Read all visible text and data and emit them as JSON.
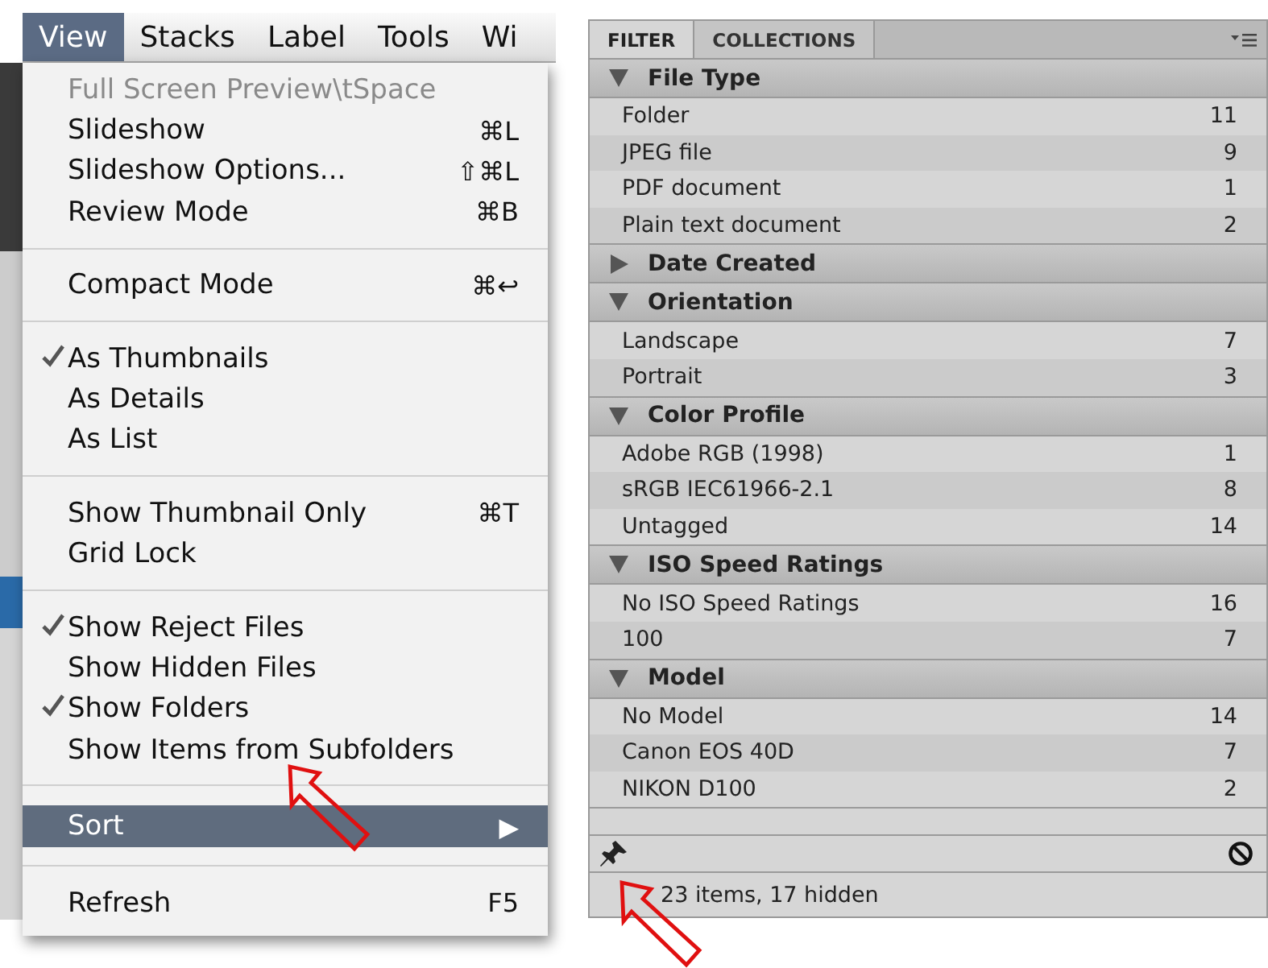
{
  "menu_bar": {
    "items": [
      {
        "label": "View",
        "selected": true
      },
      {
        "label": "Stacks",
        "selected": false
      },
      {
        "label": "Label",
        "selected": false
      },
      {
        "label": "Tools",
        "selected": false
      },
      {
        "label": "Wi",
        "selected": false
      }
    ]
  },
  "menu": {
    "items": [
      {
        "kind": "item",
        "label": "Full Screen Preview\\tSpace",
        "disabled": true,
        "checked": false,
        "selected": false
      },
      {
        "kind": "item",
        "label": "Slideshow",
        "shortcut": "⌘L",
        "disabled": false,
        "checked": false,
        "selected": false
      },
      {
        "kind": "item",
        "label": "Slideshow Options...",
        "shortcut": "⇧⌘L",
        "disabled": false,
        "checked": false,
        "selected": false
      },
      {
        "kind": "item",
        "label": "Review Mode",
        "shortcut": "⌘B",
        "disabled": false,
        "checked": false,
        "selected": false
      },
      {
        "kind": "separator"
      },
      {
        "kind": "item",
        "label": "Compact Mode",
        "shortcut": "⌘↩",
        "disabled": false,
        "checked": false,
        "selected": false
      },
      {
        "kind": "separator"
      },
      {
        "kind": "item",
        "label": "As Thumbnails",
        "disabled": false,
        "checked": true,
        "selected": false
      },
      {
        "kind": "item",
        "label": "As Details",
        "disabled": false,
        "checked": false,
        "selected": false
      },
      {
        "kind": "item",
        "label": "As List",
        "disabled": false,
        "checked": false,
        "selected": false
      },
      {
        "kind": "separator"
      },
      {
        "kind": "item",
        "label": "Show Thumbnail Only",
        "shortcut": "⌘T",
        "disabled": false,
        "checked": false,
        "selected": false
      },
      {
        "kind": "item",
        "label": "Grid Lock",
        "disabled": false,
        "checked": false,
        "selected": false
      },
      {
        "kind": "separator"
      },
      {
        "kind": "item",
        "label": "Show Reject Files",
        "disabled": false,
        "checked": true,
        "selected": false
      },
      {
        "kind": "item",
        "label": "Show Hidden Files",
        "disabled": false,
        "checked": false,
        "selected": false
      },
      {
        "kind": "item",
        "label": "Show Folders",
        "disabled": false,
        "checked": true,
        "selected": false
      },
      {
        "kind": "item",
        "label": "Show Items from Subfolders",
        "disabled": false,
        "checked": false,
        "selected": false
      },
      {
        "kind": "separator"
      },
      {
        "kind": "submenu",
        "label": "Sort",
        "arrow": "▶",
        "disabled": false,
        "checked": false,
        "selected": true
      },
      {
        "kind": "separator"
      },
      {
        "kind": "item",
        "label": "Refresh",
        "shortcut": "F5",
        "disabled": false,
        "checked": false,
        "selected": false
      }
    ]
  },
  "filter_panel": {
    "tabs": [
      {
        "label": "FILTER",
        "selected": true
      },
      {
        "label": "COLLECTIONS",
        "selected": false
      }
    ],
    "sections": [
      {
        "title": "File Type",
        "expanded": true,
        "rows": [
          {
            "label": "Folder",
            "count": "11"
          },
          {
            "label": "JPEG file",
            "count": "9"
          },
          {
            "label": "PDF document",
            "count": "1"
          },
          {
            "label": "Plain text document",
            "count": "2"
          }
        ]
      },
      {
        "title": "Date Created",
        "expanded": false
      },
      {
        "title": "Orientation",
        "expanded": true,
        "rows": [
          {
            "label": "Landscape",
            "count": "7"
          },
          {
            "label": "Portrait",
            "count": "3"
          }
        ]
      },
      {
        "title": "Color Profile",
        "expanded": true,
        "rows": [
          {
            "label": "Adobe RGB (1998)",
            "count": "1"
          },
          {
            "label": "sRGB IEC61966-2.1",
            "count": "8"
          },
          {
            "label": "Untagged",
            "count": "14"
          }
        ]
      },
      {
        "title": "ISO Speed Ratings",
        "expanded": true,
        "rows": [
          {
            "label": "No ISO Speed Ratings",
            "count": "16"
          },
          {
            "label": "100",
            "count": "7"
          }
        ]
      },
      {
        "title": "Model",
        "expanded": true,
        "rows": [
          {
            "label": "No Model",
            "count": "14"
          },
          {
            "label": "Canon EOS 40D",
            "count": "7"
          },
          {
            "label": "NIKON D100",
            "count": "2"
          }
        ]
      }
    ],
    "status": "23 items, 17 hidden"
  }
}
